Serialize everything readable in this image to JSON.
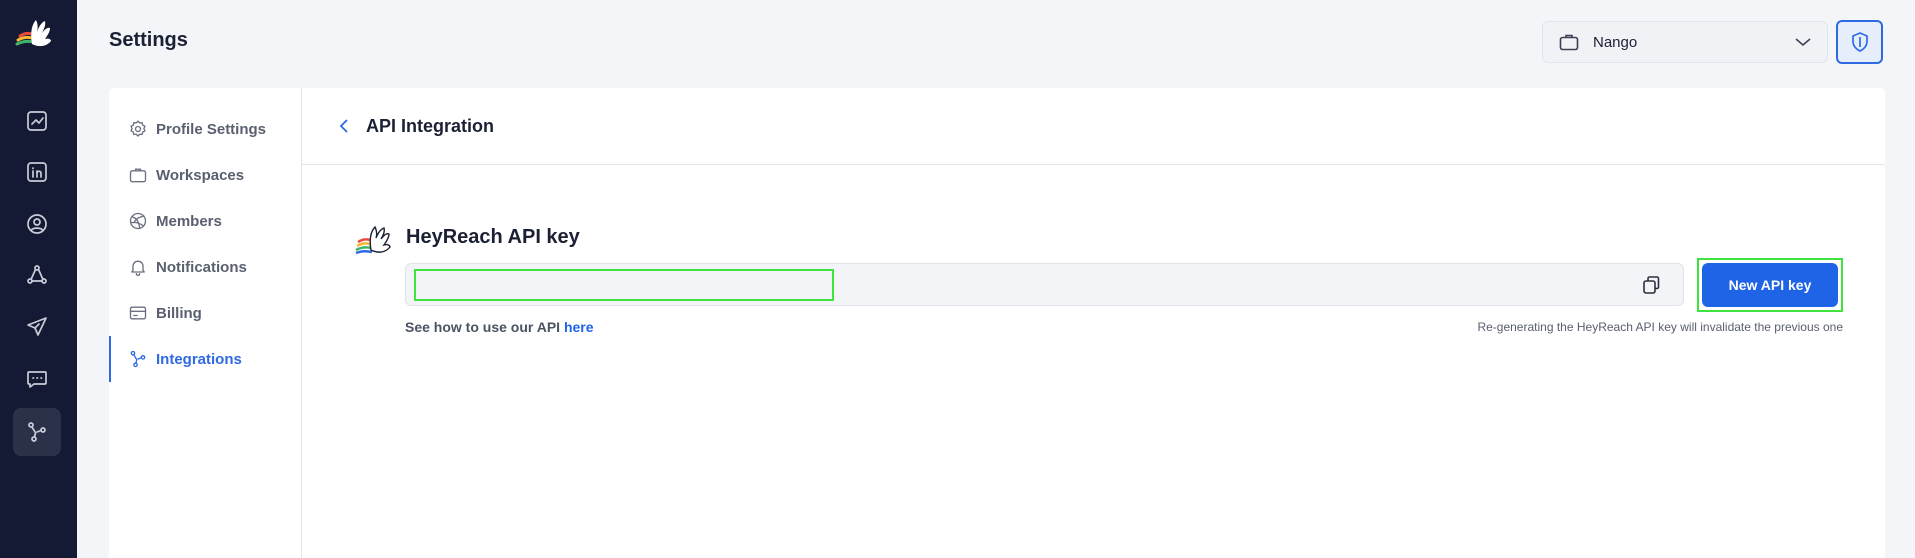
{
  "header": {
    "title": "Settings",
    "workspace_selected": "Nango"
  },
  "rail": {
    "items": [
      "logo",
      "analytics",
      "linkedin-accounts",
      "leads",
      "campaigns-network",
      "send",
      "messages",
      "integrations"
    ],
    "active": "integrations"
  },
  "sidebar": {
    "items": [
      {
        "label": "Profile Settings",
        "icon": "gear-icon"
      },
      {
        "label": "Workspaces",
        "icon": "briefcase-icon"
      },
      {
        "label": "Members",
        "icon": "globe-icon"
      },
      {
        "label": "Notifications",
        "icon": "bell-icon"
      },
      {
        "label": "Billing",
        "icon": "card-icon"
      },
      {
        "label": "Integrations",
        "icon": "integration-icon"
      }
    ],
    "active": "Integrations"
  },
  "content": {
    "title": "API Integration",
    "key_title": "HeyReach API key",
    "api_key_value": "",
    "new_key_label": "New API key",
    "help_prefix": "See how to use our API ",
    "help_link": "here",
    "warning": "Re-generating the HeyReach API key will invalidate the previous one"
  },
  "colors": {
    "rail_bg": "#141a33",
    "accent": "#1f63e6",
    "highlight": "#3ee33e"
  }
}
